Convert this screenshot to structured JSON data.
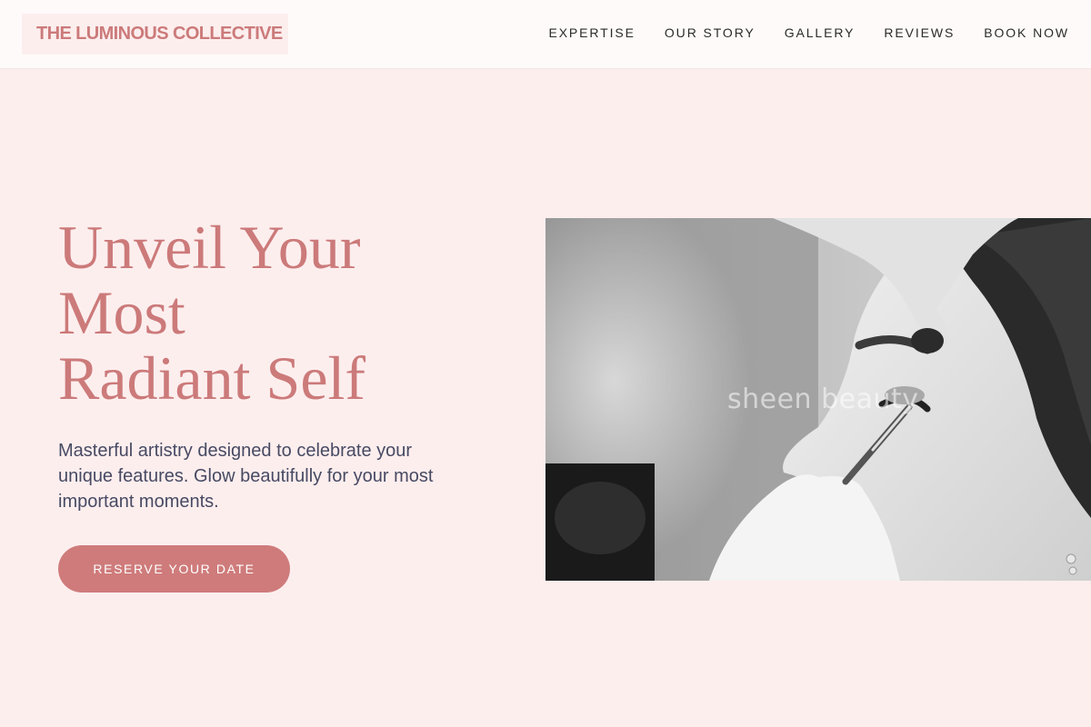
{
  "header": {
    "logo_text": "THE LUMINOUS COLLECTIVE",
    "nav": [
      {
        "label": "EXPERTISE"
      },
      {
        "label": "OUR STORY"
      },
      {
        "label": "GALLERY"
      },
      {
        "label": "REVIEWS"
      },
      {
        "label": "BOOK NOW"
      }
    ]
  },
  "hero": {
    "headline_lines": [
      "Unveil Your",
      "Most",
      "Radiant Self"
    ],
    "subtext": "Masterful artistry designed to celebrate your unique features. Glow beautifully for your most important moments.",
    "cta_label": "RESERVE YOUR DATE",
    "image_watermark": "sheen beauty"
  },
  "colors": {
    "background": "#fdeeee",
    "accent": "#cc7a7a",
    "button": "#cf7b7b",
    "body_text": "#474a63",
    "nav_text": "#2b2b2b"
  }
}
